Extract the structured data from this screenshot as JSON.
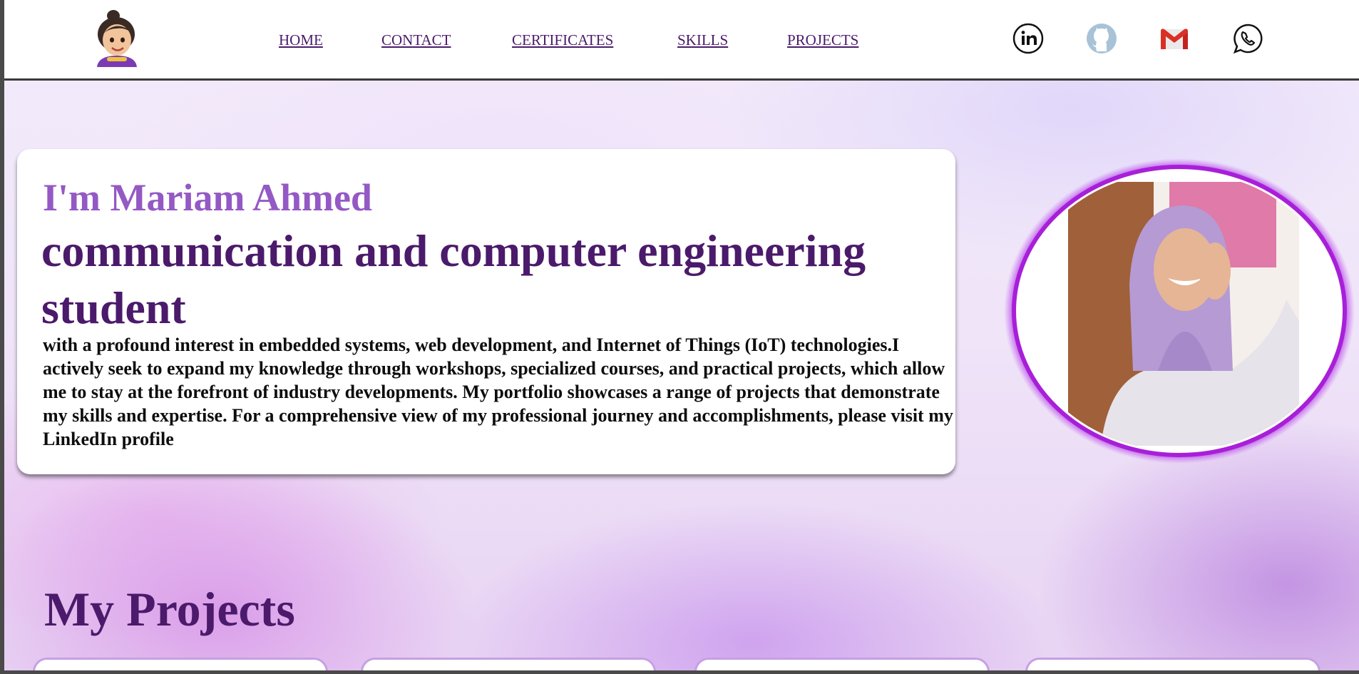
{
  "nav": {
    "links": [
      {
        "label": "HOME"
      },
      {
        "label": "CONTACT"
      },
      {
        "label": "CERTIFICATES"
      },
      {
        "label": "SKILLS"
      },
      {
        "label": "PROJECTS"
      }
    ],
    "social": [
      "linkedin-icon",
      "github-icon",
      "gmail-icon",
      "whatsapp-icon"
    ]
  },
  "hero": {
    "name": "I'm Mariam Ahmed",
    "role": "communication and computer engineering student",
    "description": "with a profound interest in embedded systems, web development, and Internet of Things (IoT) technologies.I actively seek to expand my knowledge through workshops, specialized courses, and practical projects, which allow me to stay at the forefront of industry developments. My portfolio showcases a range of projects that demonstrate my skills and expertise. For a comprehensive view of my professional journey and accomplishments, please visit my LinkedIn profile"
  },
  "projects": {
    "title": "My Projects"
  },
  "colors": {
    "accent_dark": "#4b1a6b",
    "accent_light": "#9459c4",
    "ring": "#b13ee6"
  }
}
